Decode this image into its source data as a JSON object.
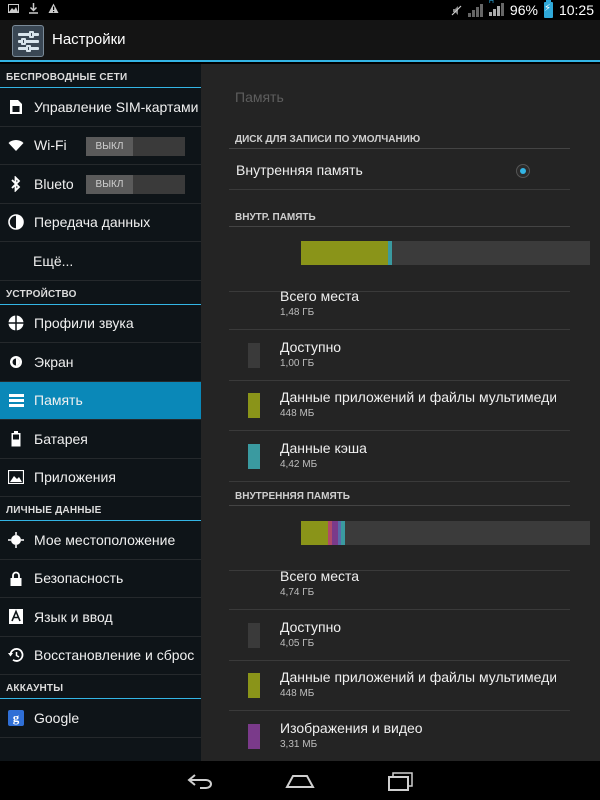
{
  "status_bar": {
    "battery_percent": "96%",
    "time": "10:25",
    "network_label": "H"
  },
  "action_bar": {
    "title": "Настройки",
    "icon": "settings-sliders-icon"
  },
  "sidebar": {
    "sections": [
      {
        "header": "БЕСПРОВОДНЫЕ СЕТИ",
        "items": [
          {
            "label": "Управление SIM-картами",
            "icon": "sim-card-icon"
          },
          {
            "label": "Wi-Fi",
            "icon": "wifi-icon",
            "toggle": "ВЫКЛ"
          },
          {
            "label": "Bluetooth",
            "icon": "bluetooth-icon",
            "toggle": "ВЫКЛ"
          },
          {
            "label": "Передача данных",
            "icon": "data-usage-icon"
          },
          {
            "label": "Ещё...",
            "icon": ""
          }
        ]
      },
      {
        "header": "УСТРОЙСТВО",
        "items": [
          {
            "label": "Профили звука",
            "icon": "sound-profile-icon"
          },
          {
            "label": "Экран",
            "icon": "display-brightness-icon"
          },
          {
            "label": "Память",
            "icon": "storage-icon",
            "selected": true
          },
          {
            "label": "Батарея",
            "icon": "battery-icon"
          },
          {
            "label": "Приложения",
            "icon": "apps-icon"
          }
        ]
      },
      {
        "header": "ЛИЧНЫЕ ДАННЫЕ",
        "items": [
          {
            "label": "Мое местоположение",
            "icon": "location-icon"
          },
          {
            "label": "Безопасность",
            "icon": "lock-icon"
          },
          {
            "label": "Язык и ввод",
            "icon": "language-keyboard-icon"
          },
          {
            "label": "Восстановление и сброс",
            "icon": "backup-restore-icon"
          }
        ]
      },
      {
        "header": "АККАУНТЫ",
        "items": [
          {
            "label": "Google",
            "icon": "google-icon"
          }
        ]
      }
    ]
  },
  "main": {
    "title": "Память",
    "default_disk": {
      "header": "ДИСК ДЛЯ ЗАПИСИ ПО УМОЛЧАНИЮ",
      "option": "Внутренняя память",
      "selected": true
    },
    "internal_storage": {
      "header": "ВНУТР. ПАМЯТЬ",
      "usage_bar": [
        {
          "color": "#8a9419",
          "fraction": 0.3
        },
        {
          "color": "#3a9aa0",
          "fraction": 0.015
        }
      ],
      "rows": [
        {
          "label": "Всего места",
          "value": "1,48 ГБ",
          "color": ""
        },
        {
          "label": "Доступно",
          "value": "1,00 ГБ",
          "color": "#3a3a3a"
        },
        {
          "label": "Данные приложений и файлы мультимедиа",
          "value": "448 МБ",
          "color": "#8a9419"
        },
        {
          "label": "Данные кэша",
          "value": "4,42 МБ",
          "color": "#3a9aa0"
        }
      ]
    },
    "sd_storage": {
      "header": "ВНУТРЕННЯЯ ПАМЯТЬ",
      "usage_bar": [
        {
          "color": "#8a9419",
          "fraction": 0.095
        },
        {
          "color": "#b04a6a",
          "fraction": 0.012
        },
        {
          "color": "#7a3a8a",
          "fraction": 0.02
        },
        {
          "color": "#5a6aa8",
          "fraction": 0.012
        },
        {
          "color": "#3a9aa0",
          "fraction": 0.012
        }
      ],
      "rows": [
        {
          "label": "Всего места",
          "value": "4,74 ГБ",
          "color": ""
        },
        {
          "label": "Доступно",
          "value": "4,05 ГБ",
          "color": "#3a3a3a"
        },
        {
          "label": "Данные приложений и файлы мультимедиа",
          "value": "448 МБ",
          "color": "#8a9419"
        },
        {
          "label": "Изображения и видео",
          "value": "3,31 МБ",
          "color": "#7a3a8a"
        }
      ]
    }
  },
  "nav_bar": {
    "back_icon": "back-icon",
    "home_icon": "home-icon",
    "recents_icon": "recent-apps-icon"
  }
}
